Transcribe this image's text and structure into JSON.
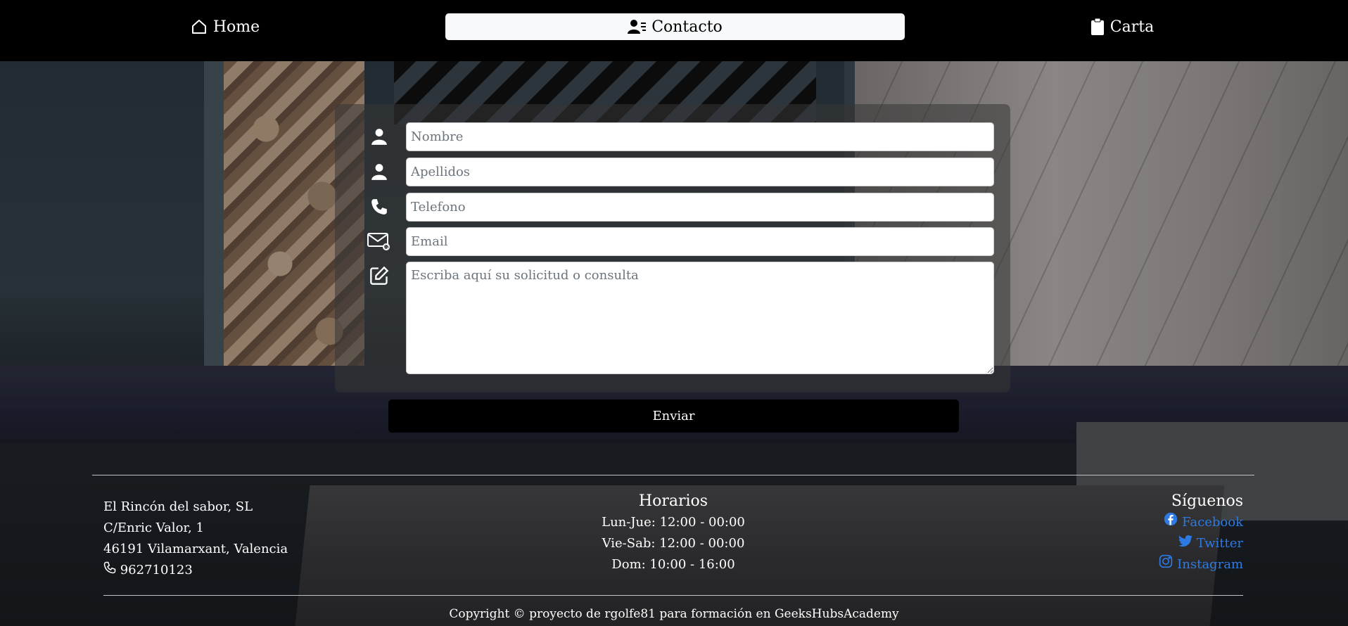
{
  "nav": {
    "home_label": "Home",
    "contact_label": "Contacto",
    "menu_label": "Carta"
  },
  "form": {
    "name_placeholder": "Nombre",
    "surname_placeholder": "Apellidos",
    "phone_placeholder": "Telefono",
    "email_placeholder": "Email",
    "message_placeholder": "Escriba aquí su solicitud o consulta",
    "submit_label": "Enviar"
  },
  "footer": {
    "address": {
      "company": "El Rincón del sabor, SL",
      "street": "C/Enric Valor, 1",
      "city": "46191 Vilamarxant, Valencia",
      "phone": "962710123"
    },
    "hours": {
      "title": "Horarios",
      "weekdays": "Lun-Jue: 12:00 - 00:00",
      "weekend": "Vie-Sab: 12:00 - 00:00",
      "sunday": "Dom: 10:00 - 16:00"
    },
    "social": {
      "title": "Síguenos",
      "facebook": "Facebook",
      "twitter": "Twitter",
      "instagram": "Instagram"
    },
    "copyright": "Copyright © proyecto de rgolfe81 para formación en GeeksHubsAcademy"
  },
  "colors": {
    "navbar_bg": "#000000",
    "active_tab_bg": "#f8f9fa",
    "link_color": "#2c7be5",
    "button_bg": "#000000"
  }
}
